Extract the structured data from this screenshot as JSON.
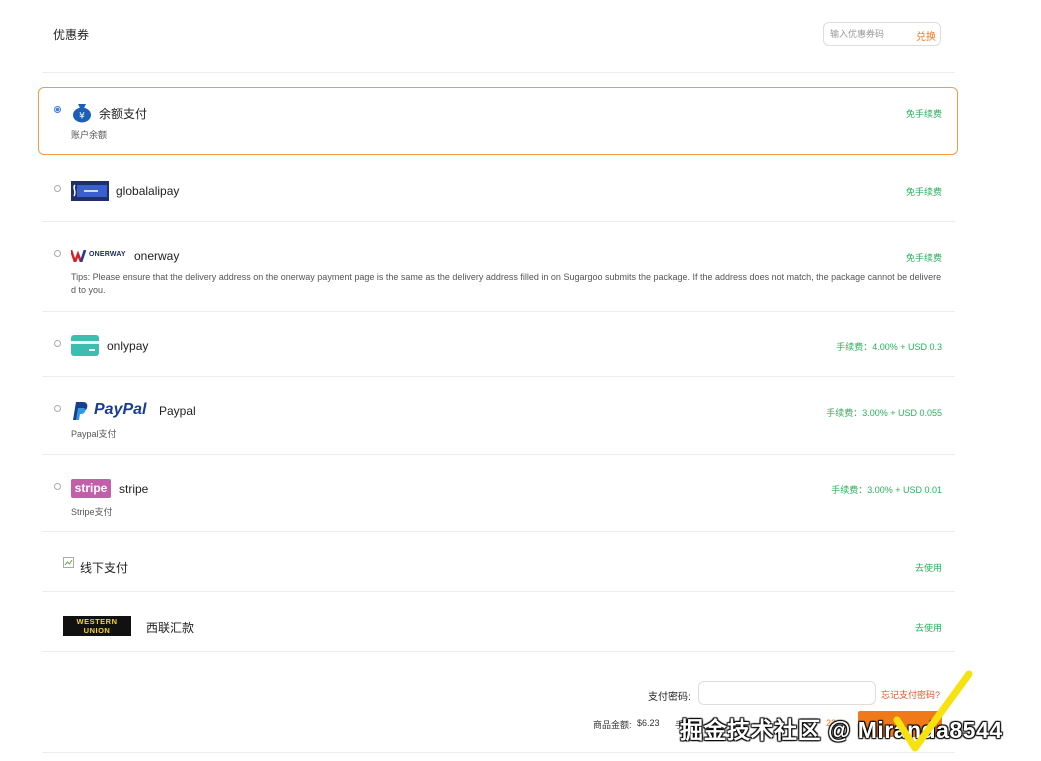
{
  "coupon": {
    "title": "优惠券",
    "placeholder": "输入优惠券码",
    "redeem_label": "兑换"
  },
  "colors": {
    "accent": "#f07a1a",
    "fee_green": "#27b15a",
    "selected_border": "#f39a4a",
    "radio_blue": "#3a78e8"
  },
  "methods": [
    {
      "id": "balance",
      "name": "余额支付",
      "sub": "账户余额",
      "fee": "免手续费",
      "selected": true,
      "icon": "money-bag-icon"
    },
    {
      "id": "globalalipay",
      "name": "globalalipay",
      "fee": "免手续费",
      "selected": false,
      "icon": "globalalipay-logo"
    },
    {
      "id": "onerway",
      "name": "onerway",
      "logo_text": "ONERWAY",
      "fee": "免手续费",
      "selected": false,
      "icon": "onerway-logo",
      "tips": "Tips: Please ensure that the delivery address on the onerway payment page is the same as the delivery address filled in on Sugargoo submits the package. If the address does not match, the package cannot be delivered to you."
    },
    {
      "id": "onlypay",
      "name": "onlypay",
      "fee": "手续费：4.00% + USD 0.3",
      "selected": false,
      "icon": "card-icon"
    },
    {
      "id": "paypal",
      "name": "Paypal",
      "logo_text": "PayPal",
      "sub": "Paypal支付",
      "fee": "手续费：3.00% + USD 0.055",
      "selected": false,
      "icon": "paypal-logo"
    },
    {
      "id": "stripe",
      "name": "stripe",
      "logo_text": "stripe",
      "sub": "Stripe支付",
      "fee": "手续费：3.00% + USD 0.01",
      "selected": false,
      "icon": "stripe-logo"
    },
    {
      "id": "offline",
      "name": "线下支付",
      "fee": "去使用",
      "icon": "broken-image-icon"
    },
    {
      "id": "western_union",
      "name": "西联汇款",
      "logo_line1": "WESTERN",
      "logo_line2": "UNION",
      "fee": "去使用",
      "icon": "western-union-logo"
    }
  ],
  "footer": {
    "password_label": "支付密码:",
    "forgot_label": "忘记支付密码?",
    "goods_total_label": "商品金额:",
    "goods_total_value": "$6.23",
    "fee_label_partial": "手",
    "amount_partial": "23"
  },
  "watermark": "掘金技术社区 @ Miranda8544"
}
